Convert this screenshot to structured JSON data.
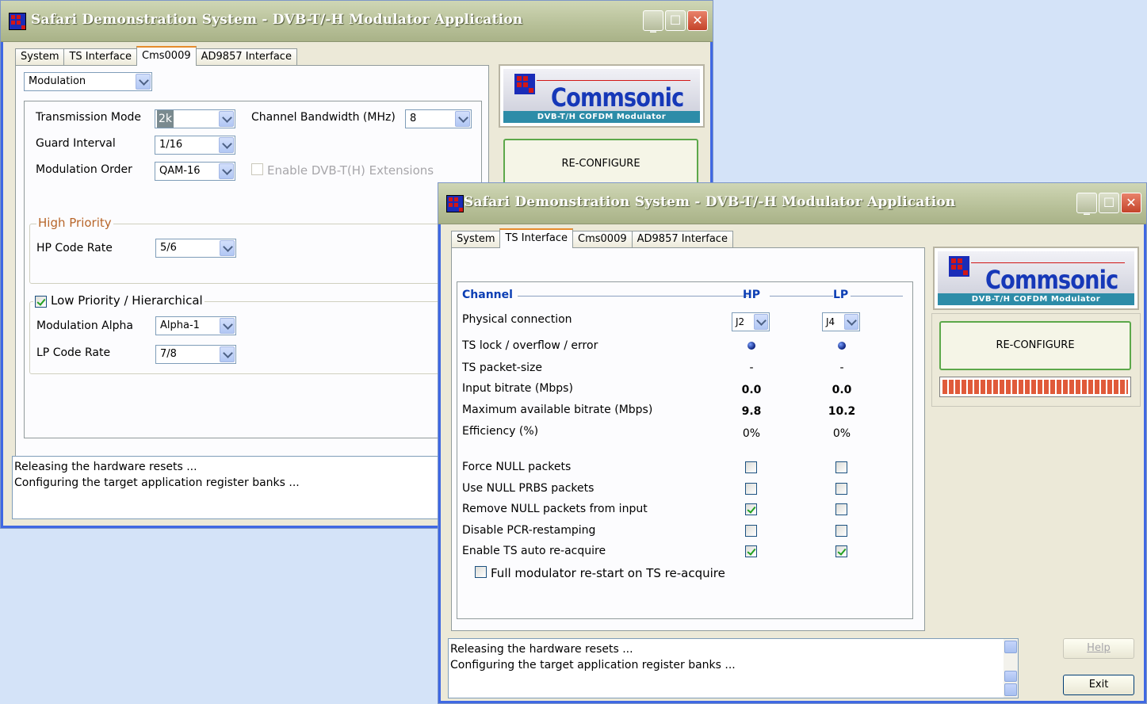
{
  "back_window": {
    "title": "Safari Demonstration System - DVB-T/-H Modulator Application",
    "tabs": [
      "System",
      "TS Interface",
      "Cms0009",
      "AD9857 Interface"
    ],
    "active_tab": "Cms0009",
    "section_select": "Modulation",
    "transmission_mode_label": "Transmission Mode",
    "transmission_mode_value": "2k",
    "channel_bandwidth_label": "Channel Bandwidth (MHz)",
    "channel_bandwidth_value": "8",
    "guard_interval_label": "Guard Interval",
    "guard_interval_value": "1/16",
    "modulation_order_label": "Modulation Order",
    "modulation_order_value": "QAM-16",
    "enable_ext_label": "Enable DVB-T(H) Extensions",
    "high_priority_legend": "High Priority",
    "hp_code_rate_label": "HP Code Rate",
    "hp_code_rate_value": "5/6",
    "low_priority_legend": "Low Priority / Hierarchical",
    "modulation_alpha_label": "Modulation Alpha",
    "modulation_alpha_value": "Alpha-1",
    "lp_code_rate_label": "LP Code Rate",
    "lp_code_rate_value": "7/8",
    "logo_name": "Commsonic",
    "logo_sub": "DVB-T/H COFDM Modulator",
    "reconfigure_label": "RE-CONFIGURE",
    "log_lines": [
      "Releasing the hardware resets ...",
      "Configuring the target application register banks ..."
    ]
  },
  "front_window": {
    "title": "Safari Demonstration System - DVB-T/-H Modulator Application",
    "tabs": [
      "System",
      "TS Interface",
      "Cms0009",
      "AD9857 Interface"
    ],
    "active_tab": "TS Interface",
    "channel_heading": "Channel",
    "hp_heading": "HP",
    "lp_heading": "LP",
    "rows": {
      "physical_connection": {
        "label": "Physical connection",
        "hp": "J2",
        "lp": "J4"
      },
      "ts_lock": {
        "label": "TS lock / overflow / error"
      },
      "ts_packet_size": {
        "label": "TS packet-size",
        "hp": "-",
        "lp": "-"
      },
      "input_bitrate": {
        "label": "Input bitrate (Mbps)",
        "hp": "0.0",
        "lp": "0.0"
      },
      "max_bitrate": {
        "label": "Maximum available bitrate (Mbps)",
        "hp": "9.8",
        "lp": "10.2"
      },
      "efficiency": {
        "label": "Efficiency (%)",
        "hp": "0%",
        "lp": "0%"
      }
    },
    "checkbox_rows": [
      {
        "label": "Force NULL packets",
        "hp": false,
        "lp": false
      },
      {
        "label": "Use NULL PRBS packets",
        "hp": false,
        "lp": false
      },
      {
        "label": "Remove NULL packets from input",
        "hp": true,
        "lp": false
      },
      {
        "label": "Disable PCR-restamping",
        "hp": false,
        "lp": false
      },
      {
        "label": "Enable TS auto re-acquire",
        "hp": true,
        "lp": true
      }
    ],
    "full_restart_label": "Full modulator re-start on TS re-acquire",
    "logo_name": "Commsonic",
    "logo_sub": "DVB-T/H COFDM Modulator",
    "reconfigure_label": "RE-CONFIGURE",
    "progress_value": 1.0,
    "log_lines": [
      "Releasing the hardware resets ...",
      "Configuring the target application register banks ..."
    ],
    "help_label": "Help",
    "exit_label": "Exit"
  }
}
